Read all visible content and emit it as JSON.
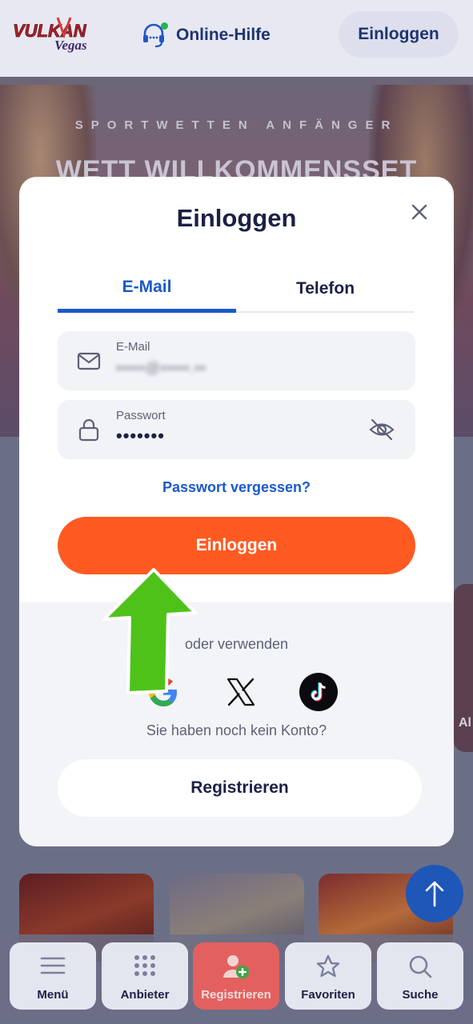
{
  "header": {
    "logo_text": "VULKAN Vegas",
    "online_help_label": "Online-Hilfe",
    "login_button_label": "Einloggen"
  },
  "hero": {
    "kicker": "SPORTWETTEN ANFÄNGER",
    "headline": "WETT WILLKOMMENSSET"
  },
  "background": {
    "side_card_text": "Al"
  },
  "modal": {
    "title": "Einloggen",
    "tabs": [
      {
        "label": "E-Mail",
        "active": true
      },
      {
        "label": "Telefon",
        "active": false
      }
    ],
    "email_field": {
      "label": "E-Mail",
      "value": "•••••@•••••.••"
    },
    "password_field": {
      "label": "Passwort",
      "value": "•••••••"
    },
    "forgot_password": "Passwort vergessen?",
    "login_button": "Einloggen",
    "or_use": "oder verwenden",
    "social": [
      "google-icon",
      "x-icon",
      "tiktok-icon"
    ],
    "no_account": "Sie haben noch kein Konto?",
    "register_button": "Registrieren"
  },
  "bottom_nav": {
    "items": [
      {
        "label": "Menü",
        "icon": "menu-icon"
      },
      {
        "label": "Anbieter",
        "icon": "grid-icon"
      },
      {
        "label": "Registrieren",
        "icon": "add-user-icon"
      },
      {
        "label": "Favoriten",
        "icon": "star-icon"
      },
      {
        "label": "Suche",
        "icon": "search-icon"
      }
    ]
  },
  "colors": {
    "accent_blue": "#1a5ac9",
    "login_orange": "#ff5a22",
    "arrow_green": "#4fc21a",
    "navy_text": "#1c2045"
  }
}
